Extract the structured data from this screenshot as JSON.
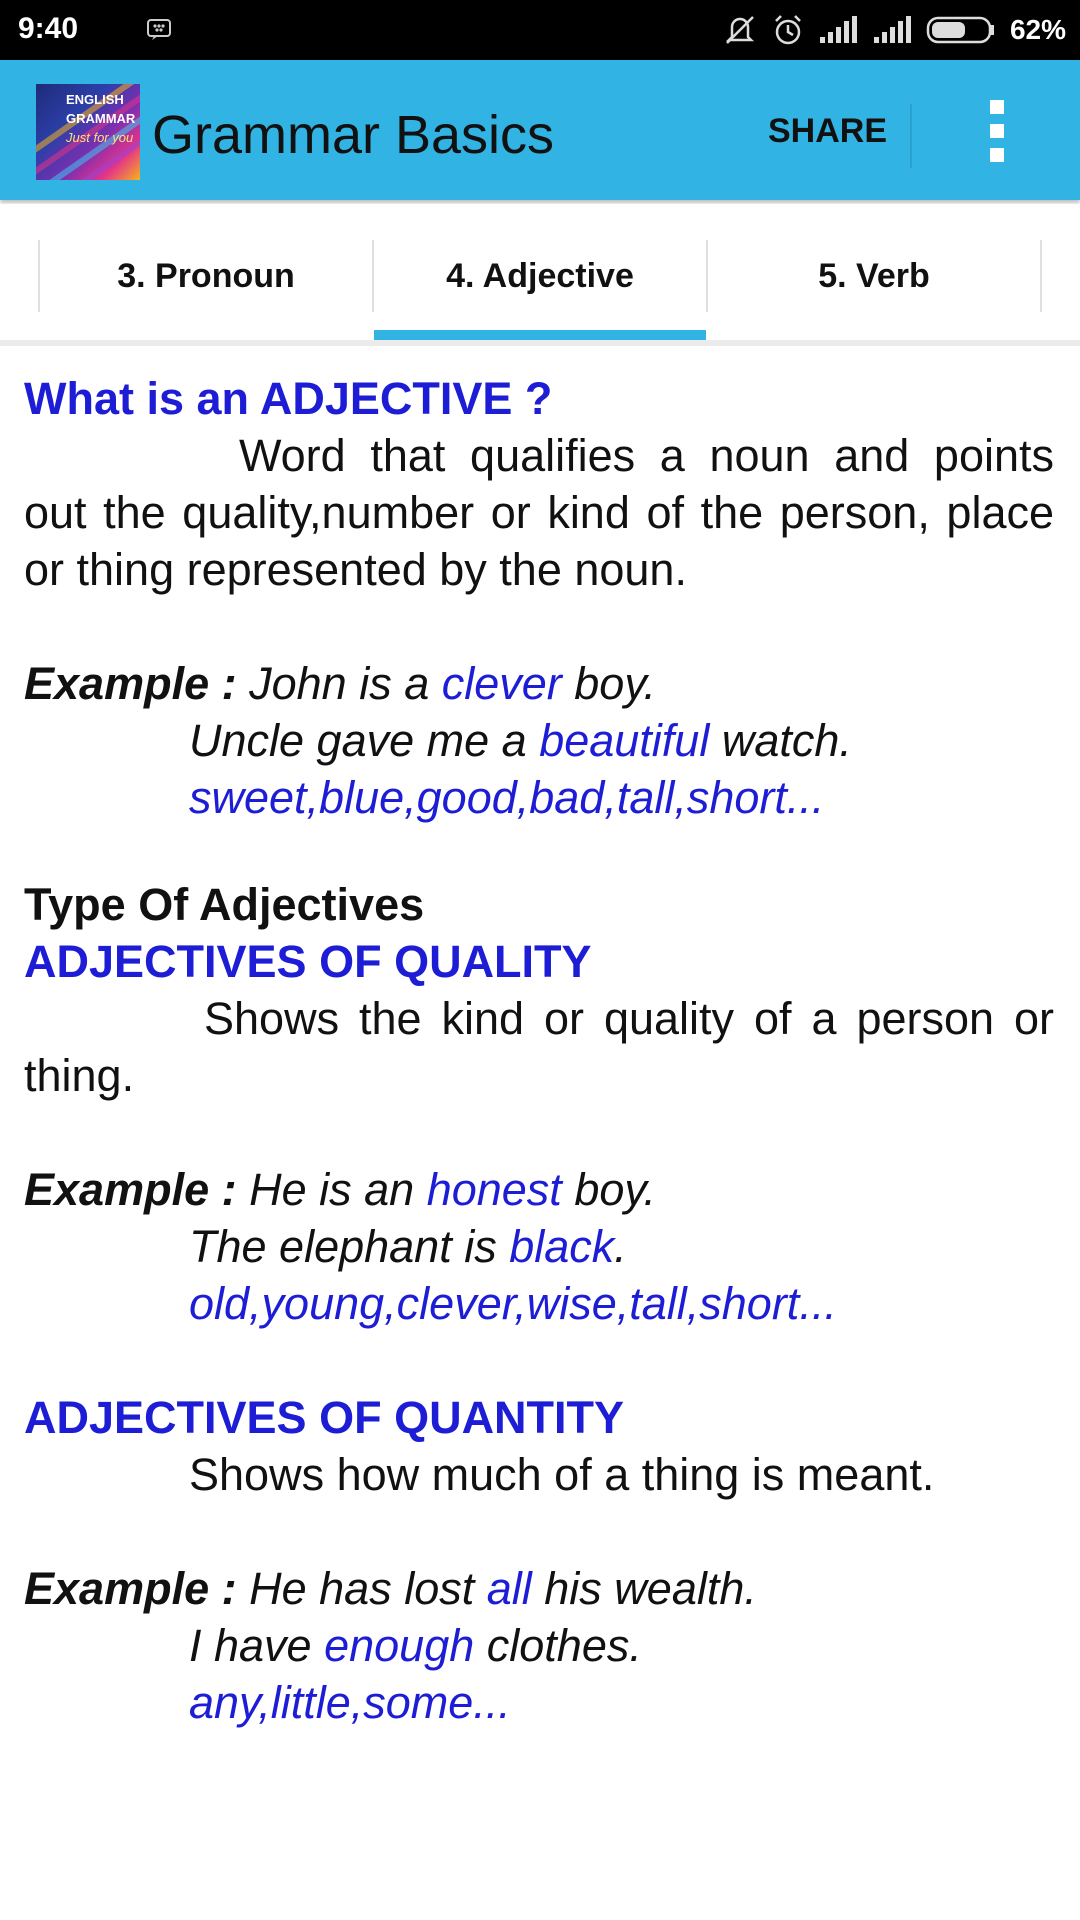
{
  "status_bar": {
    "time": "9:40",
    "battery_percent": "62%",
    "battery_level": 0.62,
    "icons": [
      "blackberry-messenger-icon",
      "mute-icon",
      "alarm-icon",
      "signal-icon",
      "signal-icon",
      "battery-icon"
    ]
  },
  "app_bar": {
    "title": "Grammar Basics",
    "share_label": "SHARE",
    "logo": {
      "line1": "ENGLISH",
      "line2": "GRAMMAR",
      "line3": "Just for you"
    },
    "color": "#31b3e4"
  },
  "tabs": {
    "items": [
      {
        "label": "3. Pronoun",
        "selected": false
      },
      {
        "label": "4. Adjective",
        "selected": true
      },
      {
        "label": "5. Verb",
        "selected": false
      }
    ]
  },
  "content": {
    "heading": "What is an ADJECTIVE ?",
    "definition": "Word that qualifies a noun and points out the quality,number or kind of the person, place or thing represented by the noun.",
    "example_label": "Example :",
    "example1": {
      "line1_pre": "John is a ",
      "line1_hl": "clever",
      "line1_post": " boy.",
      "line2_pre": "Uncle gave me a ",
      "line2_hl": "beautiful",
      "line2_post": " watch.",
      "line3": "sweet,blue,good,bad,tall,short..."
    },
    "types_heading": "Type Of Adjectives",
    "quality": {
      "heading": "ADJECTIVES OF QUALITY",
      "description": "Shows the kind or quality of a person or thing.",
      "line1_pre": "He is an ",
      "line1_hl": "honest",
      "line1_post": " boy.",
      "line2_pre": "The elephant is ",
      "line2_hl": "black",
      "line2_post": ".",
      "line3": "old,young,clever,wise,tall,short..."
    },
    "quantity": {
      "heading": "ADJECTIVES OF QUANTITY",
      "description": "Shows how much of a thing is meant.",
      "line1_pre": "He has lost ",
      "line1_hl": "all",
      "line1_post": " his wealth.",
      "line2_pre": "I have ",
      "line2_hl": "enough",
      "line2_post": " clothes.",
      "line3": "any,little,some..."
    },
    "highlight_color": "#1d1dd6"
  }
}
